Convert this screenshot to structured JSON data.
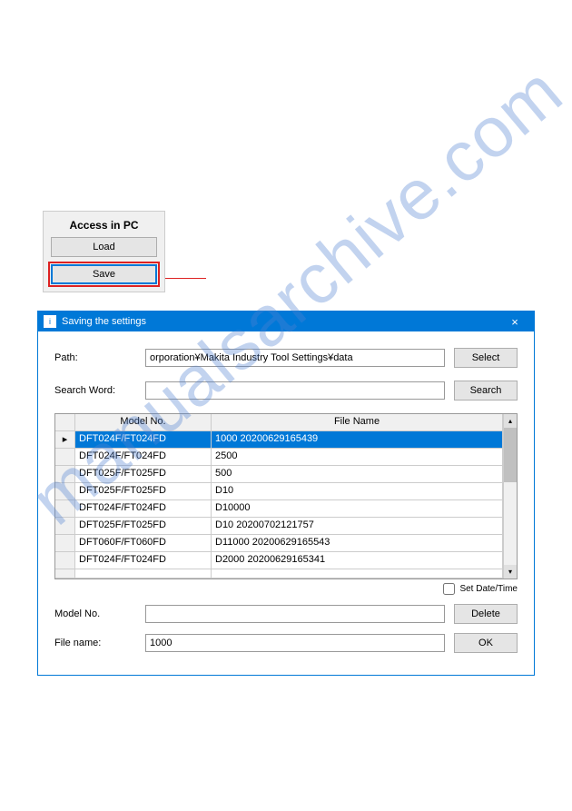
{
  "watermark": "manualsarchive.com",
  "access_panel": {
    "title": "Access in PC",
    "load_label": "Load",
    "save_label": "Save"
  },
  "dialog": {
    "title": "Saving the settings",
    "path_label": "Path:",
    "path_value": "orporation¥Makita Industry Tool Settings¥data",
    "select_label": "Select",
    "search_label": "Search Word:",
    "search_value": "",
    "search_btn_label": "Search",
    "table": {
      "header_model": "Model No.",
      "header_file": "File Name",
      "rows": [
        {
          "model": "DFT024F/FT024FD",
          "file": "1000 20200629165439",
          "selected": true
        },
        {
          "model": "DFT024F/FT024FD",
          "file": "2500",
          "selected": false
        },
        {
          "model": "DFT025F/FT025FD",
          "file": "500",
          "selected": false
        },
        {
          "model": "DFT025F/FT025FD",
          "file": "D10",
          "selected": false
        },
        {
          "model": "DFT024F/FT024FD",
          "file": "D10000",
          "selected": false
        },
        {
          "model": "DFT025F/FT025FD",
          "file": "D10 20200702121757",
          "selected": false
        },
        {
          "model": "DFT060F/FT060FD",
          "file": "D11000 20200629165543",
          "selected": false
        },
        {
          "model": "DFT024F/FT024FD",
          "file": "D2000 20200629165341",
          "selected": false
        }
      ]
    },
    "set_datetime_label": "Set Date/Time",
    "model_no_label": "Model No.",
    "model_no_value": "",
    "delete_label": "Delete",
    "file_name_label": "File name:",
    "file_name_value": "1000",
    "ok_label": "OK"
  }
}
